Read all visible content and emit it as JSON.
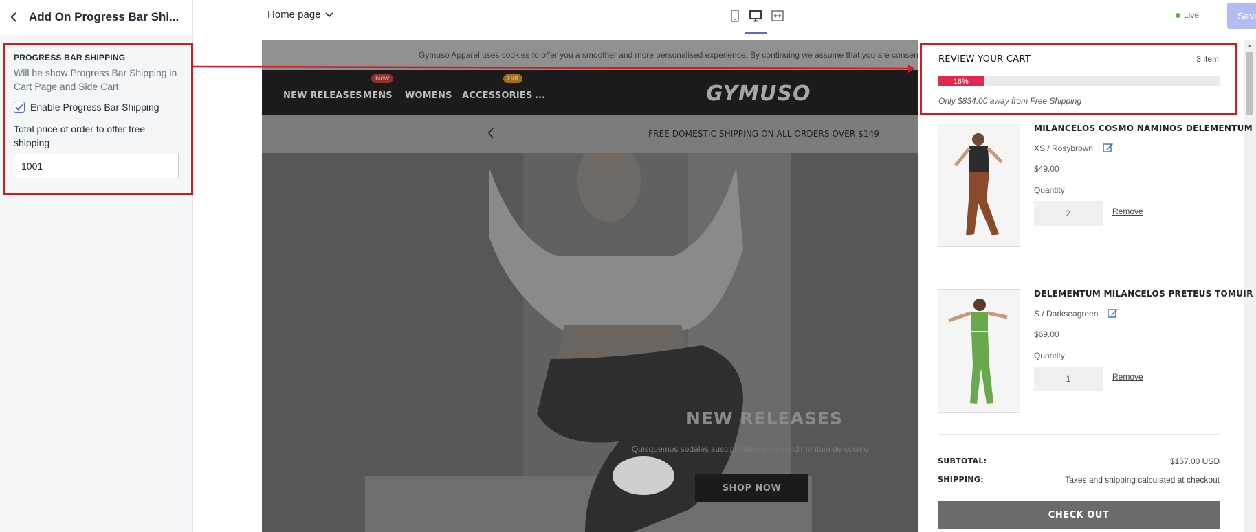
{
  "topbar": {
    "section_title": "Add On Progress Bar Shi...",
    "page_select": "Home page",
    "live_label": "Live",
    "save_label": "Save"
  },
  "settings": {
    "heading": "PROGRESS BAR SHIPPING",
    "description": "Will be show Progress Bar Shipping in Cart Page and Side Cart",
    "checkbox_label": "Enable Progress Bar Shipping",
    "checkbox_checked": true,
    "total_label": "Total price of order to offer free shipping",
    "total_value": "1001"
  },
  "store": {
    "cookie_text": "Gymuso Apparel uses cookies to offer you a smoother and more personalised experience. By continuing we assume that you are consen",
    "nav": [
      {
        "label": "NEW RELEASES",
        "badge": ""
      },
      {
        "label": "MENS",
        "badge": "New"
      },
      {
        "label": "WOMENS",
        "badge": ""
      },
      {
        "label": "ACCESSORIES",
        "badge": "Hot"
      },
      {
        "label": "...",
        "badge": ""
      }
    ],
    "logo": "GYMUSO",
    "announcement": "FREE DOMESTIC SHIPPING ON ALL ORDERS OVER $149",
    "hero_title": "NEW RELEASES",
    "hero_subtitle": "Quisquemos sodales suscipit ditaemcos condimentum de cosmo",
    "hero_button": "SHOP NOW"
  },
  "cart": {
    "title": "REVIEW YOUR CART",
    "count": "3 item",
    "progress_percent": 16,
    "progress_label": "16%",
    "progress_note": "Only $834.00 away from Free Shipping",
    "items": [
      {
        "name": "MILANCELOS COSMO NAMINOS DELEMENTUM",
        "variant": "XS / Rosybrown",
        "price": "$49.00",
        "qty_label": "Quantity",
        "qty": "2",
        "remove": "Remove"
      },
      {
        "name": "DELEMENTUM MILANCELOS PRETEUS TOMUIR",
        "variant": "S / Darkseagreen",
        "price": "$69.00",
        "qty_label": "Quantity",
        "qty": "1",
        "remove": "Remove"
      }
    ],
    "subtotal_label": "SUBTOTAL:",
    "subtotal_value": "$167.00 USD",
    "shipping_label": "SHIPPING:",
    "shipping_value": "Taxes and shipping calculated at checkout",
    "checkout_label": "CHECK OUT"
  },
  "colors": {
    "highlight_red": "#d01c1c",
    "progress_fill": "#e0294f",
    "accent": "#5c6ac4",
    "live_green": "#50b83c"
  }
}
